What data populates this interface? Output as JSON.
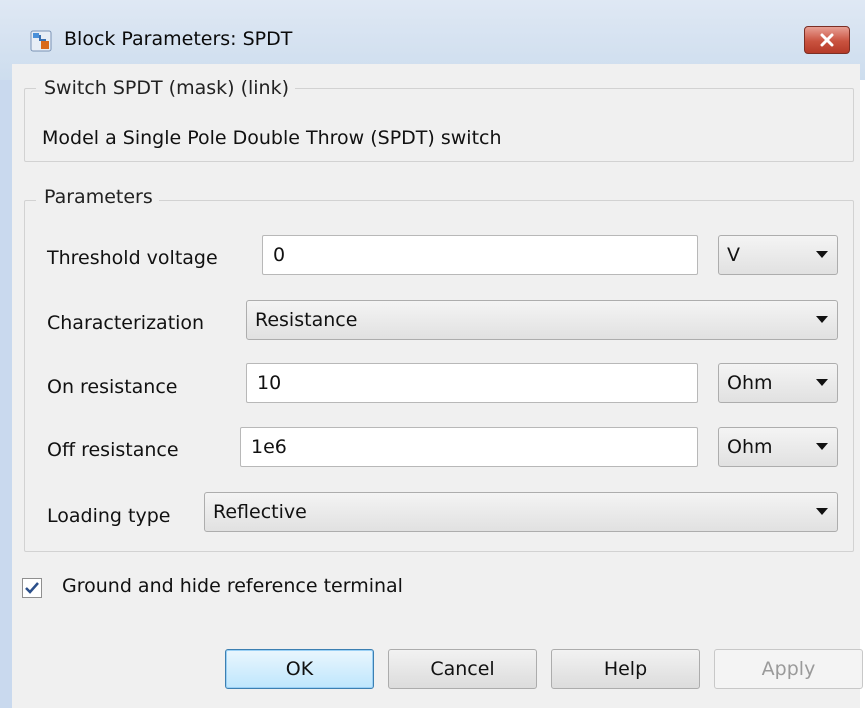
{
  "window": {
    "title": "Block Parameters: SPDT",
    "icon": "simulink-block-icon",
    "close_icon": "close-icon"
  },
  "description": {
    "group_title": "Switch SPDT (mask) (link)",
    "text": "Model a Single Pole Double Throw (SPDT) switch"
  },
  "parameters": {
    "group_title": "Parameters",
    "threshold_voltage": {
      "label": "Threshold voltage",
      "value": "0",
      "unit": "V"
    },
    "characterization": {
      "label": "Characterization",
      "value": "Resistance"
    },
    "on_resistance": {
      "label": "On resistance",
      "value": "10",
      "unit": "Ohm"
    },
    "off_resistance": {
      "label": "Off resistance",
      "value": "1e6",
      "unit": "Ohm"
    },
    "loading_type": {
      "label": "Loading type",
      "value": "Reflective"
    }
  },
  "ground_checkbox": {
    "label": "Ground and hide reference terminal",
    "checked": true
  },
  "buttons": {
    "ok": "OK",
    "cancel": "Cancel",
    "help": "Help",
    "apply": "Apply"
  },
  "colors": {
    "close_button": "#c9523f",
    "window_frame": "#c9d9ee",
    "dialog_bg": "#f0f0f0"
  }
}
